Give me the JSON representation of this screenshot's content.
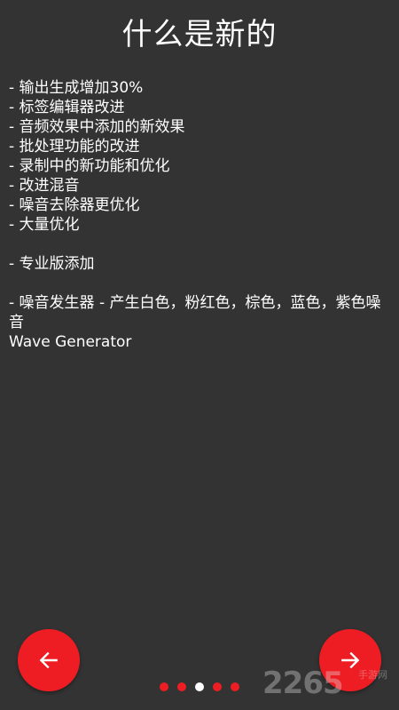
{
  "header": {
    "title": "什么是新的"
  },
  "content": {
    "lines": [
      "- 输出生成增加30%",
      "- 标签编辑器改进",
      "- 音频效果中添加的新效果",
      "- 批处理功能的改进",
      "- 录制中的新功能和优化",
      "- 改进混音",
      "- 噪音去除器更优化",
      "- 大量优化",
      "",
      "- 专业版添加",
      "",
      "- 噪音发生器 - 产生白色，粉红色，棕色，蓝色，紫色噪音",
      "Wave Generator"
    ]
  },
  "navigation": {
    "prev_icon": "arrow-left-icon",
    "next_icon": "arrow-right-icon",
    "button_color": "#ee1d23"
  },
  "pagination": {
    "total": 5,
    "current_index": 2,
    "active_color": "#ffffff",
    "inactive_color": "#ee1d23"
  },
  "watermark": {
    "text": "2265",
    "sub": "手游网"
  },
  "colors": {
    "background": "#333333",
    "text": "#ffffff",
    "accent": "#ee1d23"
  }
}
